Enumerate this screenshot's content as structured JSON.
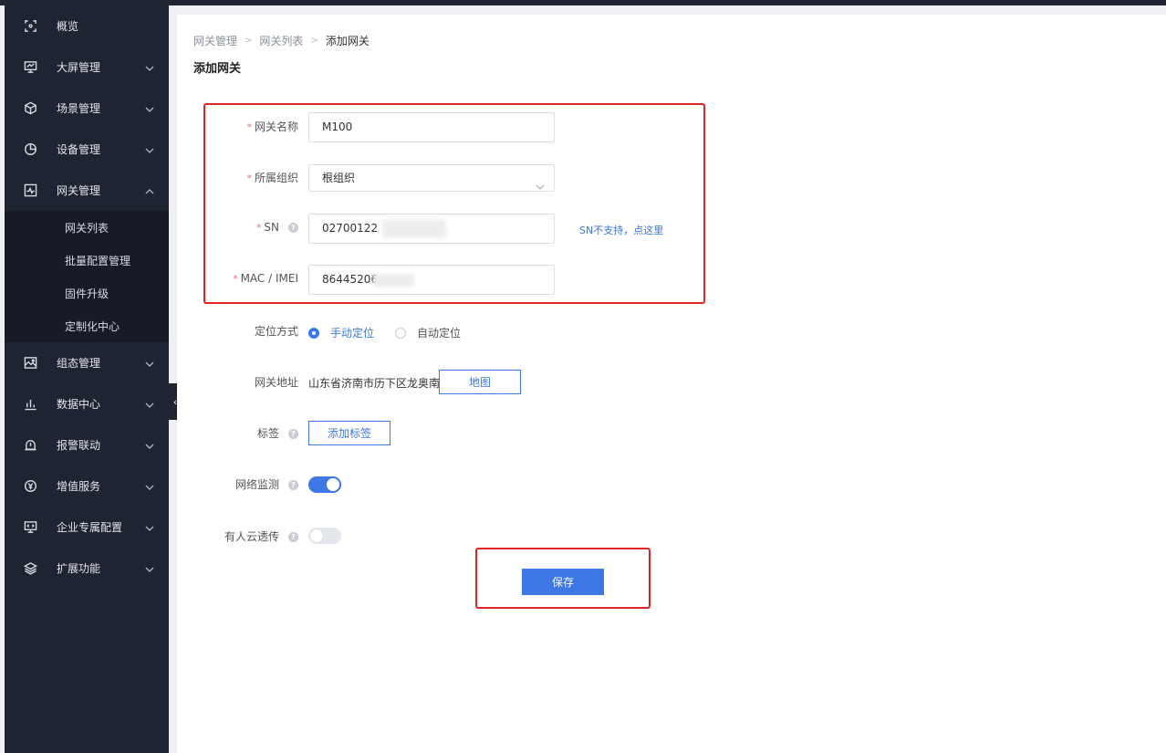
{
  "sidebar": {
    "items": [
      {
        "label": "概览",
        "icon": "overview-icon",
        "has_arrow": false
      },
      {
        "label": "大屏管理",
        "icon": "monitor-icon",
        "has_arrow": true
      },
      {
        "label": "场景管理",
        "icon": "cube-icon",
        "has_arrow": true
      },
      {
        "label": "设备管理",
        "icon": "pie-chart-icon",
        "has_arrow": true
      },
      {
        "label": "网关管理",
        "icon": "gateway-icon",
        "has_arrow": true,
        "expanded": true
      }
    ],
    "gateway_submenu": [
      "网关列表",
      "批量配置管理",
      "固件升级",
      "定制化中心"
    ],
    "items_after": [
      {
        "label": "组态管理",
        "icon": "image-icon"
      },
      {
        "label": "数据中心",
        "icon": "bar-chart-icon"
      },
      {
        "label": "报警联动",
        "icon": "alarm-icon"
      },
      {
        "label": "增值服务",
        "icon": "coin-icon"
      },
      {
        "label": "企业专属配置",
        "icon": "code-monitor-icon"
      },
      {
        "label": "扩展功能",
        "icon": "layers-icon"
      }
    ],
    "collapse_glyph": "‹"
  },
  "breadcrumb": {
    "level1": "网关管理",
    "level2": "网关列表",
    "current": "添加网关"
  },
  "page_title": "添加网关",
  "form": {
    "name_label": "网关名称",
    "name_value": "M100",
    "org_label": "所属组织",
    "org_value": "根组织",
    "sn_label": "SN",
    "sn_value": "02700122",
    "sn_link": "SN不支持，点这里",
    "mac_label": "MAC / IMEI",
    "mac_value": "86445206",
    "location_label": "定位方式",
    "location_manual": "手动定位",
    "location_auto": "自动定位",
    "address_label": "网关地址",
    "address_value": "山东省济南市历下区龙奥南路",
    "map_button": "地图",
    "tag_label": "标签",
    "add_tag_button": "添加标签",
    "network_monitor_label": "网络监测",
    "network_monitor_on": true,
    "cloud_label": "有人云透传",
    "cloud_on": false,
    "save_button": "保存",
    "required_mark": "*",
    "help_glyph": "?"
  },
  "colors": {
    "accent": "#3e77e6",
    "highlight_box": "#e02424",
    "sidebar_bg": "#1f2433"
  }
}
